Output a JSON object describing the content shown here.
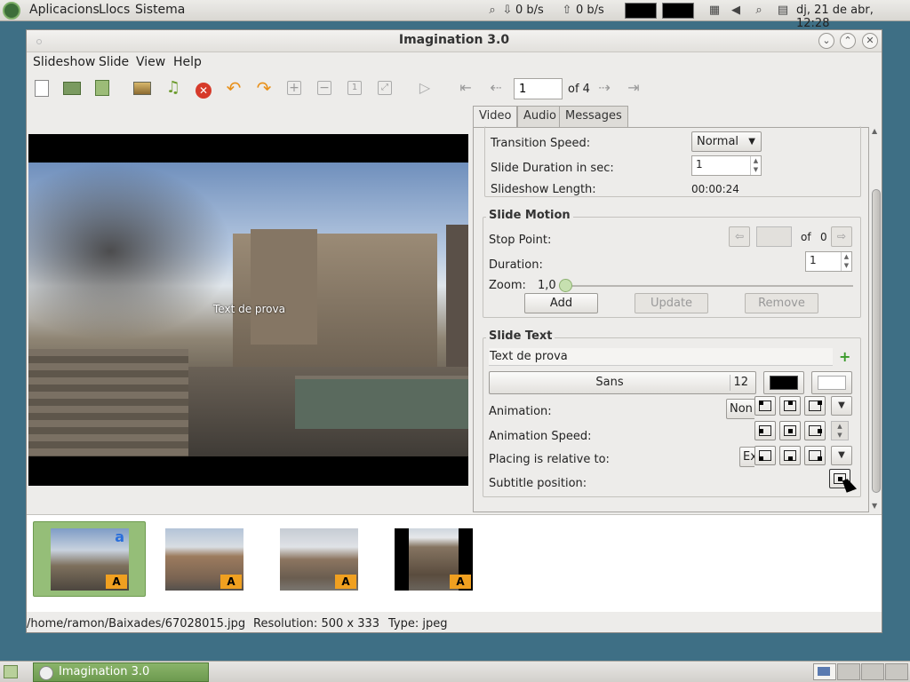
{
  "panel": {
    "menus": [
      "Aplicacions",
      "Llocs",
      "Sistema"
    ],
    "net_down": "0 b/s",
    "net_up": "0 b/s",
    "clock": "dj, 21 de abr, 12:28"
  },
  "window": {
    "title": "Imagination 3.0",
    "menus": [
      "Slideshow",
      "Slide",
      "View",
      "Help"
    ],
    "toolbar": {
      "page_value": "1",
      "page_of": "of 4"
    }
  },
  "preview": {
    "overlay_text": "Text de prova"
  },
  "tabs": [
    "Video",
    "Audio",
    "Messages"
  ],
  "video": {
    "transition_speed_label": "Transition Speed:",
    "transition_speed_value": "Normal",
    "slide_duration_label": "Slide Duration in sec:",
    "slide_duration_value": "1",
    "slideshow_length_label": "Slideshow Length:",
    "slideshow_length_value": "00:00:24"
  },
  "slide_motion": {
    "title": "Slide Motion",
    "stop_point_label": "Stop Point:",
    "stop_point_of": "of",
    "stop_point_total": "0",
    "duration_label": "Duration:",
    "duration_value": "1",
    "zoom_label": "Zoom:",
    "zoom_value": "1,0",
    "zoom_level": 0.0,
    "add": "Add",
    "update": "Update",
    "remove": "Remove"
  },
  "slide_text": {
    "title": "Slide Text",
    "text_value": "Text de prova",
    "font_name": "Sans",
    "font_size": "12",
    "text_color": "#000000",
    "bg_color": "#ffffff",
    "animation_label": "Animation:",
    "animation_value": "Non",
    "animation_speed_label": "Animation Speed:",
    "placing_label": "Placing is relative to:",
    "placing_value": "Ex",
    "subtitle_position_label": "Subtitle position:"
  },
  "thumbnails": [
    {
      "badge": "A",
      "selected": true
    },
    {
      "badge": "A",
      "selected": false
    },
    {
      "badge": "A",
      "selected": false
    },
    {
      "badge": "A",
      "selected": false
    }
  ],
  "status": {
    "path": "/home/ramon/Baixades/67028015.jpg",
    "resolution": "Resolution: 500 x 333",
    "type": "Type: jpeg"
  },
  "taskbar": {
    "task_label": "Imagination 3.0"
  }
}
